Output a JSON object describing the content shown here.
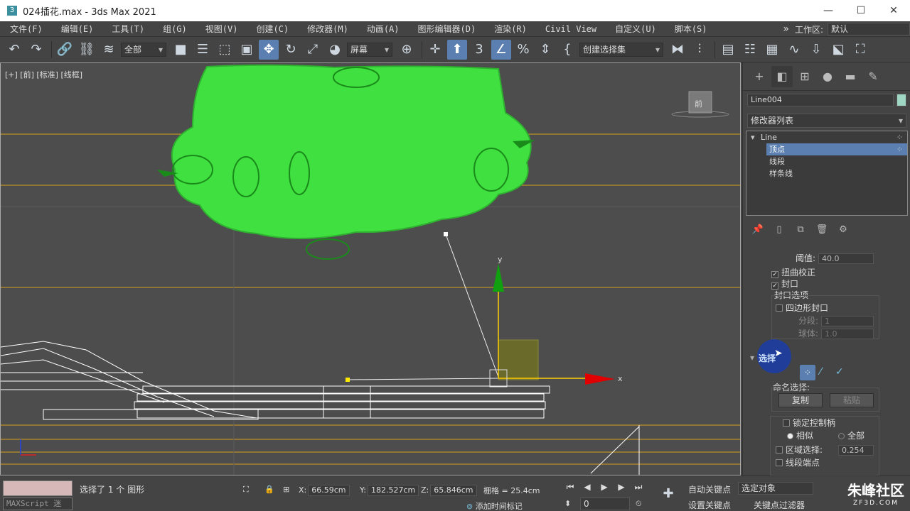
{
  "title_bar": {
    "title": "024插花.max - 3ds Max 2021",
    "minimize": "—",
    "maximize": "☐",
    "close": "✕"
  },
  "menu": {
    "items": [
      "文件(F)",
      "编辑(E)",
      "工具(T)",
      "组(G)",
      "视图(V)",
      "创建(C)",
      "修改器(M)",
      "动画(A)",
      "图形编辑器(D)",
      "渲染(R)",
      "Civil View",
      "自定义(U)",
      "脚本(S)"
    ],
    "more": "»",
    "workspace_label": "工作区:",
    "workspace_value": "默认"
  },
  "toolbar": {
    "selection_filter": "全部",
    "reference_coord": "屏幕",
    "named_selection": "创建选择集"
  },
  "viewport": {
    "label": "[+] [前] [标准] [线框]",
    "viewcube_label": "前",
    "axis_x": "x",
    "axis_y": "y"
  },
  "command_panel": {
    "object_name": "Line004",
    "modifier_list": "修改器列表",
    "stack": {
      "base": "Line",
      "sub": [
        "顶点",
        "线段",
        "样条线"
      ],
      "selected": "顶点"
    },
    "threshold_label": "阈值:",
    "threshold_value": "40.0",
    "twist_label": "扭曲校正",
    "cap_label": "封口",
    "cap_options_title": "封口选项",
    "quad_cap_label": "四边形封口",
    "segments_label": "分段:",
    "segments_value": "1",
    "sphere_label": "球体:",
    "sphere_value": "1.0",
    "selection_rollout": "选择",
    "named_sel_label": "命名选择:",
    "copy_label": "复制",
    "paste_label": "粘贴",
    "lock_handles_label": "锁定控制柄",
    "similar_label": "相似",
    "all_label": "全部",
    "area_sel_label": "区域选择:",
    "area_sel_value": "0.254",
    "segment_end_label": "线段端点"
  },
  "status_bar": {
    "maxscript": "MAXScript 迷",
    "selection": "选择了 1 个 图形",
    "x_label": "X:",
    "x_value": "66.59cm",
    "y_label": "Y:",
    "y_value": "182.527cm",
    "z_label": "Z:",
    "z_value": "65.846cm",
    "grid_label": "栅格 = 25.4cm",
    "add_time_tag": "添加时间标记",
    "auto_key": "自动关键点",
    "set_key": "设置关键点",
    "selected_object": "选定对象",
    "key_filters": "关键点过滤器",
    "frame": "0",
    "logo": "朱峰社区",
    "logo_sub": "ZF3D.COM"
  },
  "colors": {
    "accent": "#5a7fb0",
    "foliage": "#3fe040",
    "grid_orange": "#d8a020",
    "axis_red": "#e00000",
    "axis_green": "#10a010",
    "gizmo_box": "#6a6a2a"
  }
}
